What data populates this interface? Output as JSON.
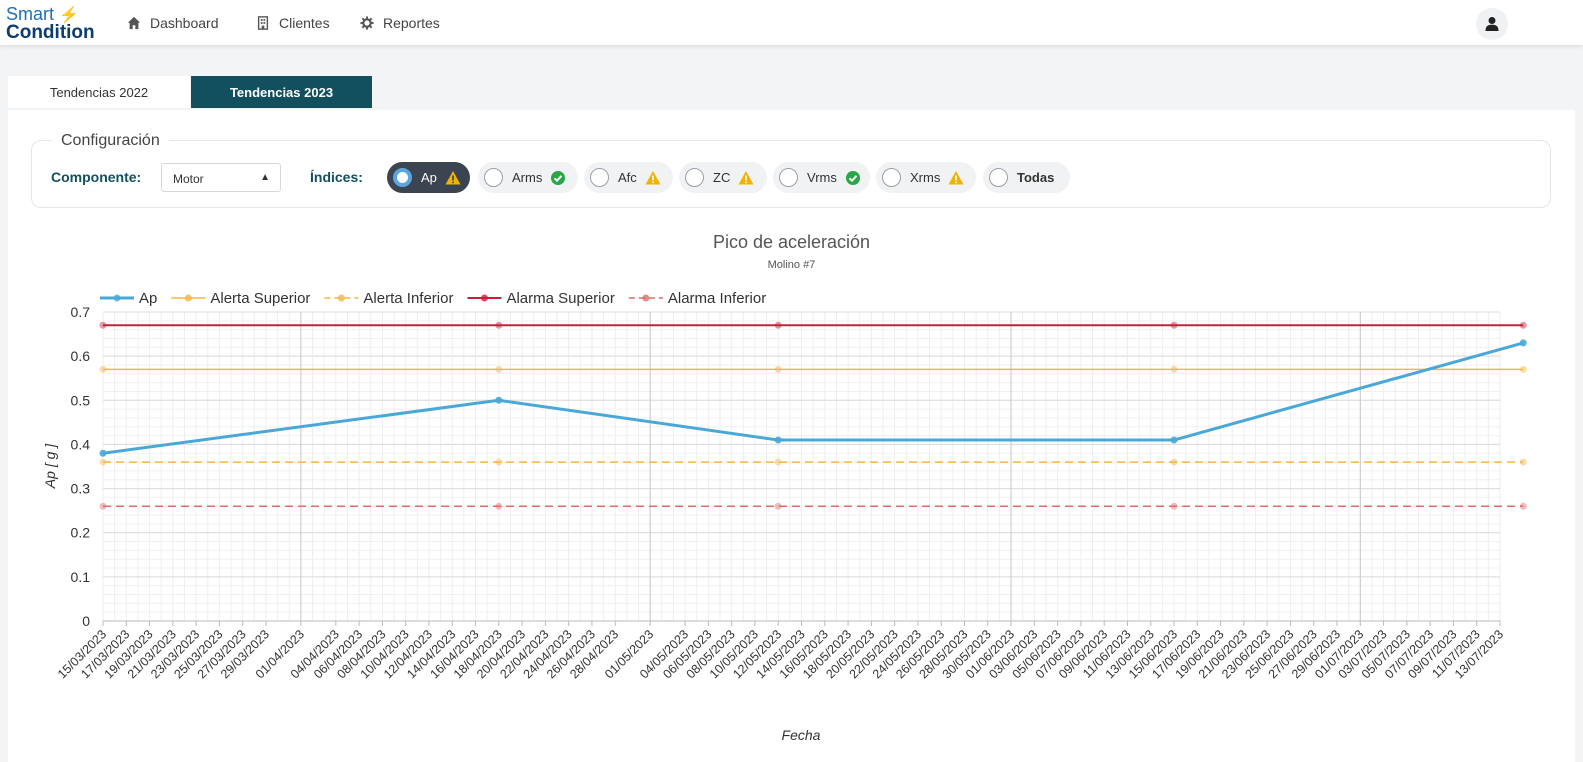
{
  "app": {
    "logo_line1": "Smart",
    "logo_line2": "Condition",
    "nav": [
      {
        "label": "Dashboard",
        "icon": "home-icon"
      },
      {
        "label": "Clientes",
        "icon": "building-icon"
      },
      {
        "label": "Reportes",
        "icon": "gear-icon"
      }
    ],
    "user_icon": "user-icon"
  },
  "tabs": [
    {
      "label": "Tendencias 2022",
      "active": false
    },
    {
      "label": "Tendencias 2023",
      "active": true
    }
  ],
  "config": {
    "legend": "Configuración",
    "component_label": "Componente:",
    "component_value": "Motor",
    "indices_label": "Índices:",
    "indices": [
      {
        "label": "Ap",
        "status": "warning",
        "selected": true
      },
      {
        "label": "Arms",
        "status": "ok",
        "selected": false
      },
      {
        "label": "Afc",
        "status": "warning",
        "selected": false
      },
      {
        "label": "ZC",
        "status": "warning",
        "selected": false
      },
      {
        "label": "Vrms",
        "status": "ok",
        "selected": false
      },
      {
        "label": "Xrms",
        "status": "warning",
        "selected": false
      },
      {
        "label": "Todas",
        "status": "",
        "selected": false
      }
    ],
    "status_colors": {
      "warning": "#f0b400",
      "ok": "#28a745"
    }
  },
  "chart_data": {
    "type": "line",
    "title": "Pico de aceleración",
    "subtitle": "Molino #7",
    "xlabel": "Fecha",
    "ylabel": "Ap [ g ]",
    "ylim": [
      0,
      0.7
    ],
    "yticks": [
      "0",
      "0.1",
      "0.2",
      "0.3",
      "0.4",
      "0.5",
      "0.6",
      "0.7"
    ],
    "grid": true,
    "legend_position": "top-left",
    "x_tick_labels": [
      "15/03/2023",
      "17/03/2023",
      "19/03/2023",
      "21/03/2023",
      "23/03/2023",
      "25/03/2023",
      "27/03/2023",
      "29/03/2023",
      "01/04/2023",
      "04/04/2023",
      "06/04/2023",
      "08/04/2023",
      "10/04/2023",
      "12/04/2023",
      "14/04/2023",
      "16/04/2023",
      "18/04/2023",
      "20/04/2023",
      "22/04/2023",
      "24/04/2023",
      "26/04/2023",
      "28/04/2023",
      "01/05/2023",
      "04/05/2023",
      "06/05/2023",
      "08/05/2023",
      "10/05/2023",
      "12/05/2023",
      "14/05/2023",
      "16/05/2023",
      "18/05/2023",
      "20/05/2023",
      "22/05/2023",
      "24/05/2023",
      "26/05/2023",
      "28/05/2023",
      "30/05/2023",
      "01/06/2023",
      "03/06/2023",
      "05/06/2023",
      "07/06/2023",
      "09/06/2023",
      "11/06/2023",
      "13/06/2023",
      "15/06/2023",
      "17/06/2023",
      "19/06/2023",
      "21/06/2023",
      "23/06/2023",
      "25/06/2023",
      "27/06/2023",
      "29/06/2023",
      "01/07/2023",
      "03/07/2023",
      "05/07/2023",
      "07/07/2023",
      "09/07/2023",
      "11/07/2023",
      "13/07/2023"
    ],
    "x": [
      "15/03/2023",
      "18/04/2023",
      "12/05/2023",
      "15/06/2023",
      "15/07/2023"
    ],
    "series": [
      {
        "name": "Ap",
        "color": "#4aa8d8",
        "dash": false,
        "width": 3,
        "values": [
          0.38,
          0.5,
          0.41,
          0.41,
          0.63
        ]
      },
      {
        "name": "Alerta Superior",
        "color": "#f5b642",
        "dash": false,
        "width": 1.5,
        "values": [
          0.57,
          0.57,
          0.57,
          0.57,
          0.57
        ]
      },
      {
        "name": "Alerta Inferior",
        "color": "#f5b642",
        "dash": true,
        "width": 1.5,
        "values": [
          0.36,
          0.36,
          0.36,
          0.36,
          0.36
        ]
      },
      {
        "name": "Alarma Superior",
        "color": "#c8203a",
        "dash": false,
        "width": 2,
        "values": [
          0.67,
          0.67,
          0.67,
          0.67,
          0.67
        ]
      },
      {
        "name": "Alarma Inferior",
        "color": "#e06c6c",
        "dash": true,
        "width": 1.5,
        "values": [
          0.26,
          0.26,
          0.26,
          0.26,
          0.26
        ]
      }
    ]
  }
}
